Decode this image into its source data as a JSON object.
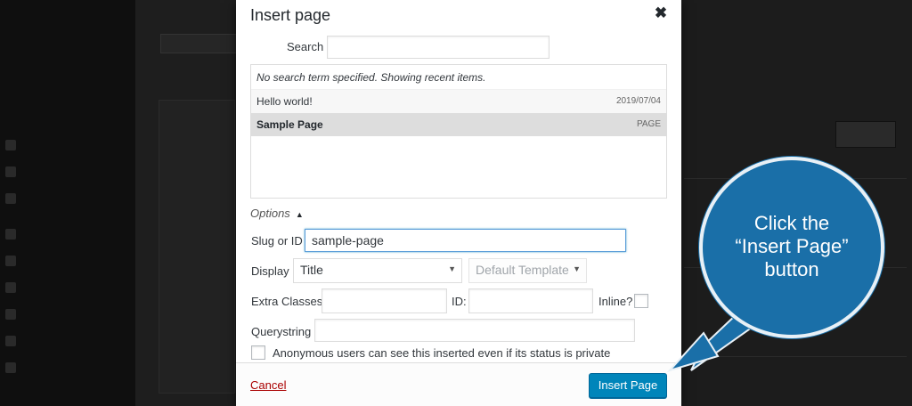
{
  "modal": {
    "title": "Insert page",
    "close_glyph": "✖",
    "search_label": "Search",
    "search_value": "",
    "results_note": "No search term specified. Showing recent items.",
    "results": [
      {
        "title": "Hello world!",
        "meta": "2019/07/04",
        "selected": false
      },
      {
        "title": "Sample Page",
        "meta": "PAGE",
        "selected": true
      }
    ],
    "options_label": "Options",
    "slug_label": "Slug or ID",
    "slug_value": "sample-page",
    "display_label": "Display",
    "display_value": "Title",
    "template_value": "Default Template",
    "extra_classes_label": "Extra Classes:",
    "id_label": "ID:",
    "inline_label": "Inline?",
    "querystring_label": "Querystring",
    "anonymous_label": "Anonymous users can see this inserted even if its status is private",
    "cancel_label": "Cancel",
    "insert_label": "Insert Page"
  },
  "callout": {
    "line1": "Click the",
    "line2": "“Insert Page”",
    "line3": "button",
    "color": "#1a6fa8"
  }
}
